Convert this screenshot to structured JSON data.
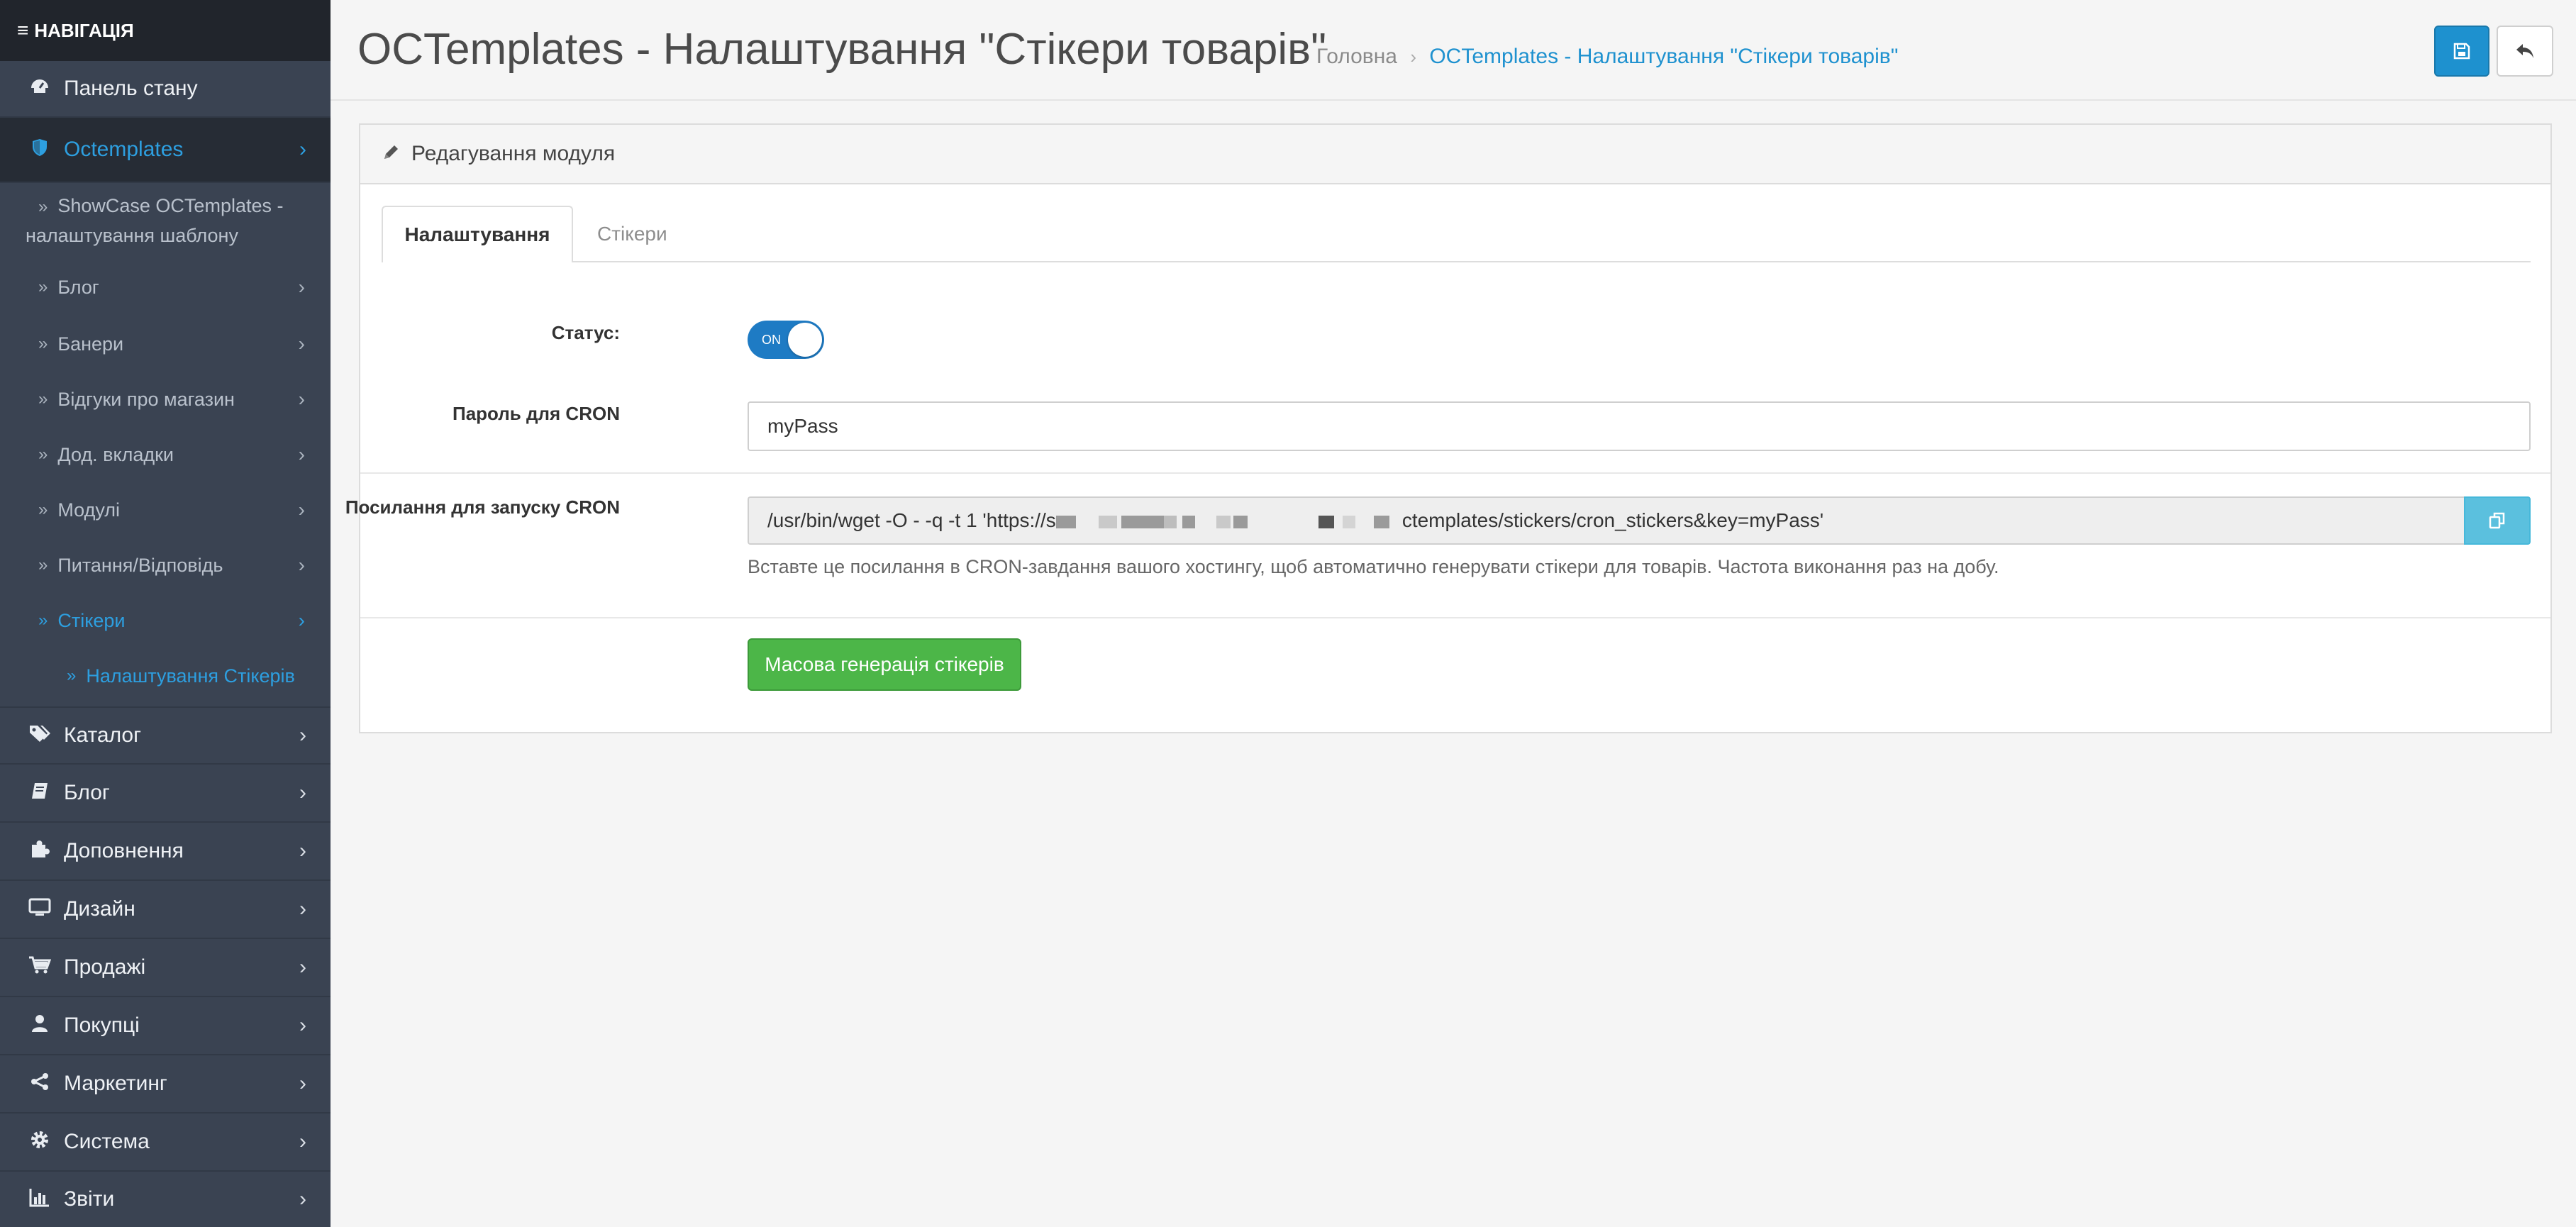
{
  "nav": {
    "heading": "НАВІГАЦІЯ",
    "items": [
      {
        "label": "Панель стану",
        "icon": "dashboard-icon"
      },
      {
        "label": "Octemplates",
        "icon": "shield-icon"
      },
      {
        "label": "Каталог",
        "icon": "tags-icon"
      },
      {
        "label": "Блог",
        "icon": "book-icon"
      },
      {
        "label": "Доповнення",
        "icon": "puzzle-icon"
      },
      {
        "label": "Дизайн",
        "icon": "monitor-icon"
      },
      {
        "label": "Продажі",
        "icon": "cart-icon"
      },
      {
        "label": "Покупці",
        "icon": "user-icon"
      },
      {
        "label": "Маркетинг",
        "icon": "share-icon"
      },
      {
        "label": "Система",
        "icon": "gear-icon"
      },
      {
        "label": "Звіти",
        "icon": "bar-chart-icon"
      }
    ],
    "sub_items": [
      {
        "label": "ShowCase OCTemplates - налаштування шаблону"
      },
      {
        "label": "Блог"
      },
      {
        "label": "Банери"
      },
      {
        "label": "Відгуки про магазин"
      },
      {
        "label": "Дод. вкладки"
      },
      {
        "label": "Модулі"
      },
      {
        "label": "Питання/Відповідь"
      },
      {
        "label": "Стікери"
      },
      {
        "label": "Налаштування Стікерів"
      }
    ]
  },
  "header": {
    "title": "OCTemplates - Налаштування \"Стікери товарів\"",
    "breadcrumb_home": "Головна",
    "breadcrumb_current": "OCTemplates - Налаштування \"Стікери товарів\""
  },
  "panel": {
    "title": "Редагування модуля",
    "tabs": [
      {
        "label": "Налаштування",
        "active": true
      },
      {
        "label": "Стікери",
        "active": false
      }
    ]
  },
  "form": {
    "status_label": "Статус:",
    "status_toggle_text": "ON",
    "status_on": true,
    "cron_password_label": "Пароль для CRON",
    "cron_password_value": "myPass",
    "cron_link_label": "Посилання для запуску CRON",
    "cron_link_start": "/usr/bin/wget -O - -q -t 1 'https://s",
    "cron_link_end": "ctemplates/stickers/cron_stickers&key=myPass'",
    "cron_help": "Вставте це посилання в CRON-завдання вашого хостингу, щоб автоматично генерувати стікери для товарів. Частота виконання раз на добу.",
    "mass_button": "Масова генерація стікерів"
  },
  "colors": {
    "sidebar_bg": "#3a4352",
    "accent": "#1e91cf",
    "success": "#4cb648",
    "info": "#5bc0de"
  }
}
